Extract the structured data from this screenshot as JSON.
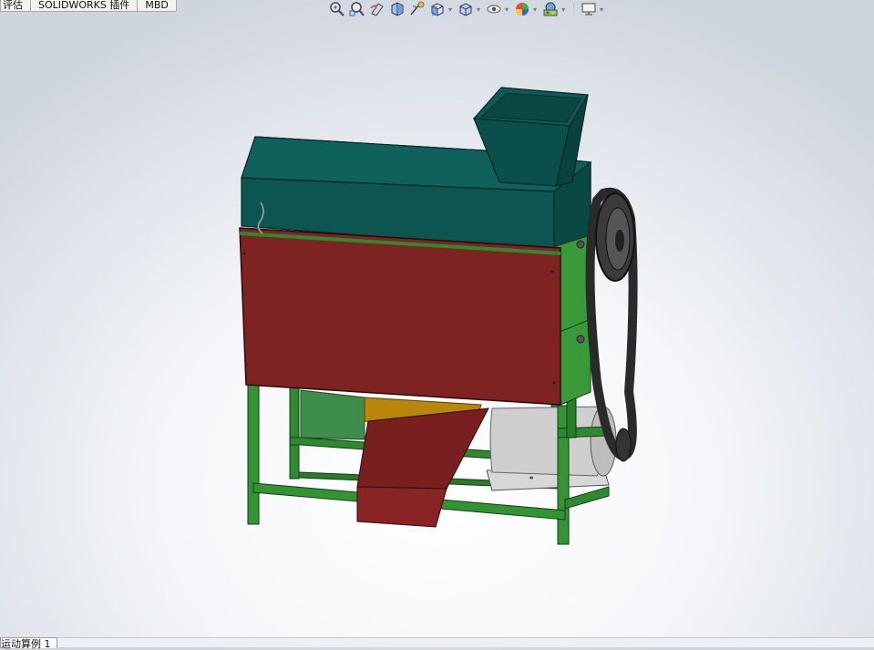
{
  "command_tabs": [
    "评估",
    "SOLIDWORKS 插件",
    "MBD"
  ],
  "heads_up_toolbar": [
    {
      "icon": "zoom-to-fit-icon"
    },
    {
      "icon": "zoom-to-area-icon"
    },
    {
      "icon": "previous-view-icon"
    },
    {
      "icon": "section-view-icon"
    },
    {
      "icon": "dynamic-annotation-icon"
    },
    {
      "icon": "view-orientation-icon",
      "dropdown": true
    },
    {
      "icon": "display-style-icon",
      "dropdown": true
    },
    {
      "icon": "hide-show-items-icon",
      "dropdown": true
    },
    {
      "icon": "edit-appearance-icon",
      "dropdown": true
    },
    {
      "icon": "apply-scene-icon",
      "dropdown": true
    },
    {
      "icon": "view-settings-icon",
      "dropdown": true
    }
  ],
  "bottom_tab": "运动算例 1",
  "colors": {
    "hood_top": "#0e5a55",
    "hood_side": "#0a4a46",
    "red_panel": "#7e2222",
    "frame_green": "#2f8a2f",
    "belt": "#2a2a2a",
    "motor": "#c8c8c8"
  }
}
